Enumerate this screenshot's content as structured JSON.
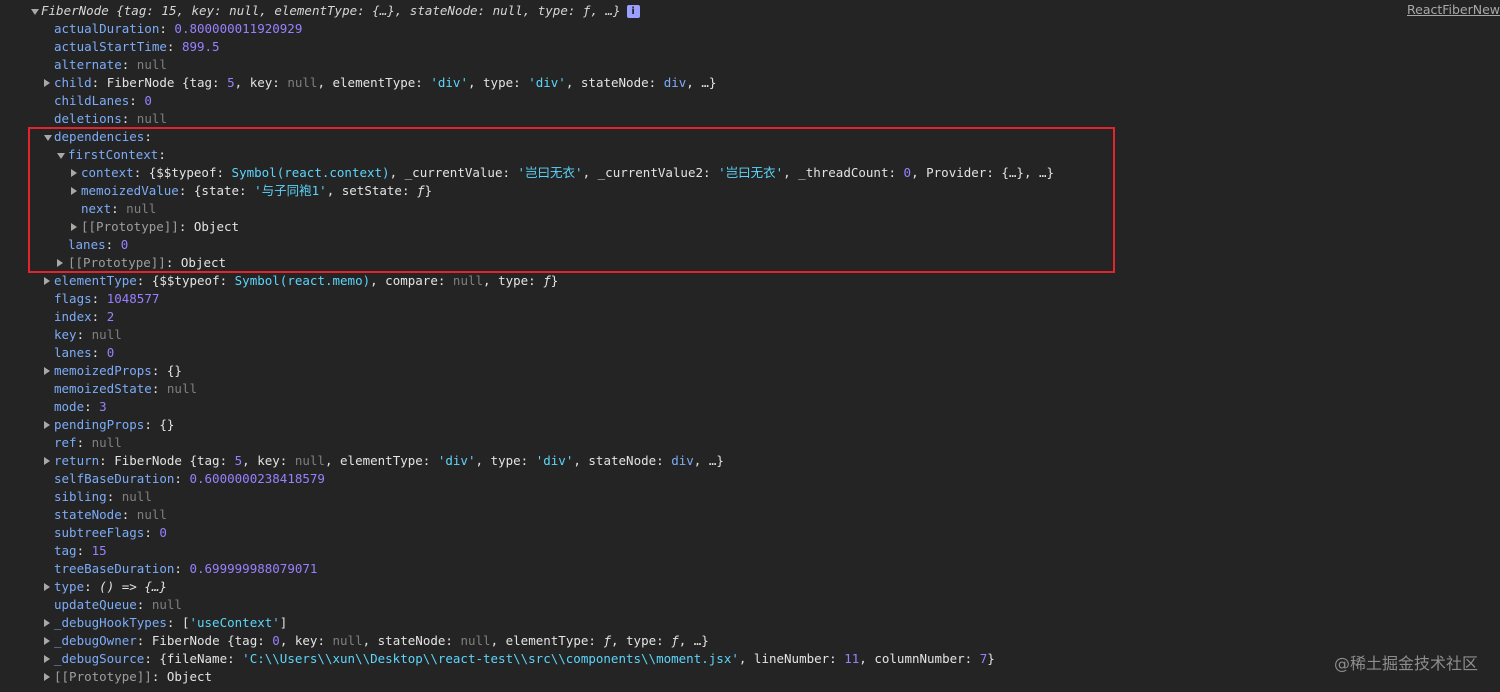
{
  "source_link": "ReactFiberNew",
  "watermark": "@稀土掘金技术社区",
  "highlight_color": "#e0252b",
  "rows": [
    {
      "indent": 0,
      "arrow": "down",
      "segs": [
        [
          "it",
          "FiberNode {tag: "
        ],
        [
          "it",
          "15"
        ],
        [
          "it",
          ", key: "
        ],
        [
          "it",
          "null"
        ],
        [
          "it",
          ", elementType: {…}, stateNode: "
        ],
        [
          "it",
          "null"
        ],
        [
          "it",
          ", type: "
        ],
        [
          "it",
          "ƒ"
        ],
        [
          "it",
          ", …}"
        ]
      ],
      "badge": "i"
    },
    {
      "indent": 1,
      "arrow": "none",
      "segs": [
        [
          "k",
          "actualDuration"
        ],
        [
          "p",
          ": "
        ],
        [
          "n",
          "0.800000011920929"
        ]
      ]
    },
    {
      "indent": 1,
      "arrow": "none",
      "segs": [
        [
          "k",
          "actualStartTime"
        ],
        [
          "p",
          ": "
        ],
        [
          "n",
          "899.5"
        ]
      ]
    },
    {
      "indent": 1,
      "arrow": "none",
      "segs": [
        [
          "k",
          "alternate"
        ],
        [
          "p",
          ": "
        ],
        [
          "nl",
          "null"
        ]
      ]
    },
    {
      "indent": 1,
      "arrow": "right",
      "segs": [
        [
          "k",
          "child"
        ],
        [
          "p",
          ": "
        ],
        [
          "cls",
          "FiberNode {tag: "
        ],
        [
          "n",
          "5"
        ],
        [
          "cls",
          ", key: "
        ],
        [
          "nl",
          "null"
        ],
        [
          "cls",
          ", elementType: "
        ],
        [
          "s",
          "'div'"
        ],
        [
          "cls",
          ", type: "
        ],
        [
          "s",
          "'div'"
        ],
        [
          "cls",
          ", stateNode: "
        ],
        [
          "k",
          "div"
        ],
        [
          "cls",
          ", …}"
        ]
      ]
    },
    {
      "indent": 1,
      "arrow": "none",
      "segs": [
        [
          "k",
          "childLanes"
        ],
        [
          "p",
          ": "
        ],
        [
          "n",
          "0"
        ]
      ]
    },
    {
      "indent": 1,
      "arrow": "none",
      "segs": [
        [
          "k",
          "deletions"
        ],
        [
          "p",
          ": "
        ],
        [
          "nl",
          "null"
        ]
      ]
    },
    {
      "indent": 1,
      "arrow": "down",
      "segs": [
        [
          "k",
          "dependencies"
        ],
        [
          "p",
          ":"
        ]
      ]
    },
    {
      "indent": 2,
      "arrow": "down",
      "segs": [
        [
          "k",
          "firstContext"
        ],
        [
          "p",
          ":"
        ]
      ]
    },
    {
      "indent": 3,
      "arrow": "right",
      "segs": [
        [
          "k",
          "context"
        ],
        [
          "p",
          ": "
        ],
        [
          "c",
          "{$$typeof: "
        ],
        [
          "s",
          "Symbol(react.context)"
        ],
        [
          "c",
          ", _currentValue: "
        ],
        [
          "s",
          "'岂曰无衣'"
        ],
        [
          "c",
          ", _currentValue2: "
        ],
        [
          "s",
          "'岂曰无衣'"
        ],
        [
          "c",
          ", _threadCount: "
        ],
        [
          "n",
          "0"
        ],
        [
          "c",
          ", Provider: {…}, …}"
        ]
      ]
    },
    {
      "indent": 3,
      "arrow": "right",
      "segs": [
        [
          "k",
          "memoizedValue"
        ],
        [
          "p",
          ": "
        ],
        [
          "c",
          "{state: "
        ],
        [
          "s",
          "'与子同袍1'"
        ],
        [
          "c",
          ", setState: "
        ],
        [
          "f",
          "ƒ"
        ],
        [
          "c",
          "}"
        ]
      ]
    },
    {
      "indent": 3,
      "arrow": "none",
      "segs": [
        [
          "k",
          "next"
        ],
        [
          "p",
          ": "
        ],
        [
          "nl",
          "null"
        ]
      ]
    },
    {
      "indent": 3,
      "arrow": "right",
      "segs": [
        [
          "kd",
          "[[Prototype]]"
        ],
        [
          "p",
          ": "
        ],
        [
          "c",
          "Object"
        ]
      ]
    },
    {
      "indent": 2,
      "arrow": "none",
      "segs": [
        [
          "k",
          "lanes"
        ],
        [
          "p",
          ": "
        ],
        [
          "n",
          "0"
        ]
      ]
    },
    {
      "indent": 2,
      "arrow": "right",
      "segs": [
        [
          "kd",
          "[[Prototype]]"
        ],
        [
          "p",
          ": "
        ],
        [
          "c",
          "Object"
        ]
      ]
    },
    {
      "indent": 1,
      "arrow": "right",
      "segs": [
        [
          "k",
          "elementType"
        ],
        [
          "p",
          ": "
        ],
        [
          "c",
          "{$$typeof: "
        ],
        [
          "s",
          "Symbol(react.memo)"
        ],
        [
          "c",
          ", compare: "
        ],
        [
          "nl",
          "null"
        ],
        [
          "c",
          ", type: "
        ],
        [
          "f",
          "ƒ"
        ],
        [
          "c",
          "}"
        ]
      ]
    },
    {
      "indent": 1,
      "arrow": "none",
      "segs": [
        [
          "k",
          "flags"
        ],
        [
          "p",
          ": "
        ],
        [
          "n",
          "1048577"
        ]
      ]
    },
    {
      "indent": 1,
      "arrow": "none",
      "segs": [
        [
          "k",
          "index"
        ],
        [
          "p",
          ": "
        ],
        [
          "n",
          "2"
        ]
      ]
    },
    {
      "indent": 1,
      "arrow": "none",
      "segs": [
        [
          "k",
          "key"
        ],
        [
          "p",
          ": "
        ],
        [
          "nl",
          "null"
        ]
      ]
    },
    {
      "indent": 1,
      "arrow": "none",
      "segs": [
        [
          "k",
          "lanes"
        ],
        [
          "p",
          ": "
        ],
        [
          "n",
          "0"
        ]
      ]
    },
    {
      "indent": 1,
      "arrow": "right",
      "segs": [
        [
          "k",
          "memoizedProps"
        ],
        [
          "p",
          ": "
        ],
        [
          "c",
          "{}"
        ]
      ]
    },
    {
      "indent": 1,
      "arrow": "none",
      "segs": [
        [
          "k",
          "memoizedState"
        ],
        [
          "p",
          ": "
        ],
        [
          "nl",
          "null"
        ]
      ]
    },
    {
      "indent": 1,
      "arrow": "none",
      "segs": [
        [
          "k",
          "mode"
        ],
        [
          "p",
          ": "
        ],
        [
          "n",
          "3"
        ]
      ]
    },
    {
      "indent": 1,
      "arrow": "right",
      "segs": [
        [
          "k",
          "pendingProps"
        ],
        [
          "p",
          ": "
        ],
        [
          "c",
          "{}"
        ]
      ]
    },
    {
      "indent": 1,
      "arrow": "none",
      "segs": [
        [
          "k",
          "ref"
        ],
        [
          "p",
          ": "
        ],
        [
          "nl",
          "null"
        ]
      ]
    },
    {
      "indent": 1,
      "arrow": "right",
      "segs": [
        [
          "k",
          "return"
        ],
        [
          "p",
          ": "
        ],
        [
          "cls",
          "FiberNode {tag: "
        ],
        [
          "n",
          "5"
        ],
        [
          "cls",
          ", key: "
        ],
        [
          "nl",
          "null"
        ],
        [
          "cls",
          ", elementType: "
        ],
        [
          "s",
          "'div'"
        ],
        [
          "cls",
          ", type: "
        ],
        [
          "s",
          "'div'"
        ],
        [
          "cls",
          ", stateNode: "
        ],
        [
          "k",
          "div"
        ],
        [
          "cls",
          ", …}"
        ]
      ]
    },
    {
      "indent": 1,
      "arrow": "none",
      "segs": [
        [
          "k",
          "selfBaseDuration"
        ],
        [
          "p",
          ": "
        ],
        [
          "n",
          "0.6000000238418579"
        ]
      ]
    },
    {
      "indent": 1,
      "arrow": "none",
      "segs": [
        [
          "k",
          "sibling"
        ],
        [
          "p",
          ": "
        ],
        [
          "nl",
          "null"
        ]
      ]
    },
    {
      "indent": 1,
      "arrow": "none",
      "segs": [
        [
          "k",
          "stateNode"
        ],
        [
          "p",
          ": "
        ],
        [
          "nl",
          "null"
        ]
      ]
    },
    {
      "indent": 1,
      "arrow": "none",
      "segs": [
        [
          "k",
          "subtreeFlags"
        ],
        [
          "p",
          ": "
        ],
        [
          "n",
          "0"
        ]
      ]
    },
    {
      "indent": 1,
      "arrow": "none",
      "segs": [
        [
          "k",
          "tag"
        ],
        [
          "p",
          ": "
        ],
        [
          "n",
          "15"
        ]
      ]
    },
    {
      "indent": 1,
      "arrow": "none",
      "segs": [
        [
          "k",
          "treeBaseDuration"
        ],
        [
          "p",
          ": "
        ],
        [
          "n",
          "0.699999988079071"
        ]
      ]
    },
    {
      "indent": 1,
      "arrow": "right",
      "segs": [
        [
          "k",
          "type"
        ],
        [
          "p",
          ": "
        ],
        [
          "f",
          "() => {…}"
        ]
      ]
    },
    {
      "indent": 1,
      "arrow": "none",
      "segs": [
        [
          "k",
          "updateQueue"
        ],
        [
          "p",
          ": "
        ],
        [
          "nl",
          "null"
        ]
      ]
    },
    {
      "indent": 1,
      "arrow": "right",
      "segs": [
        [
          "k",
          "_debugHookTypes"
        ],
        [
          "p",
          ": "
        ],
        [
          "c",
          "["
        ],
        [
          "s",
          "'useContext'"
        ],
        [
          "c",
          "]"
        ]
      ]
    },
    {
      "indent": 1,
      "arrow": "right",
      "segs": [
        [
          "k",
          "_debugOwner"
        ],
        [
          "p",
          ": "
        ],
        [
          "cls",
          "FiberNode {tag: "
        ],
        [
          "n",
          "0"
        ],
        [
          "cls",
          ", key: "
        ],
        [
          "nl",
          "null"
        ],
        [
          "cls",
          ", stateNode: "
        ],
        [
          "nl",
          "null"
        ],
        [
          "cls",
          ", elementType: "
        ],
        [
          "f",
          "ƒ"
        ],
        [
          "cls",
          ", type: "
        ],
        [
          "f",
          "ƒ"
        ],
        [
          "cls",
          ", …}"
        ]
      ]
    },
    {
      "indent": 1,
      "arrow": "right",
      "segs": [
        [
          "k",
          "_debugSource"
        ],
        [
          "p",
          ": "
        ],
        [
          "c",
          "{fileName: "
        ],
        [
          "s",
          "'C:\\\\Users\\\\xun\\\\Desktop\\\\react-test\\\\src\\\\components\\\\moment.jsx'"
        ],
        [
          "c",
          ", lineNumber: "
        ],
        [
          "n",
          "11"
        ],
        [
          "c",
          ", columnNumber: "
        ],
        [
          "n",
          "7"
        ],
        [
          "c",
          "}"
        ]
      ]
    },
    {
      "indent": 1,
      "arrow": "right",
      "segs": [
        [
          "kd",
          "[[Prototype]]"
        ],
        [
          "p",
          ": "
        ],
        [
          "c",
          "Object"
        ]
      ]
    }
  ]
}
